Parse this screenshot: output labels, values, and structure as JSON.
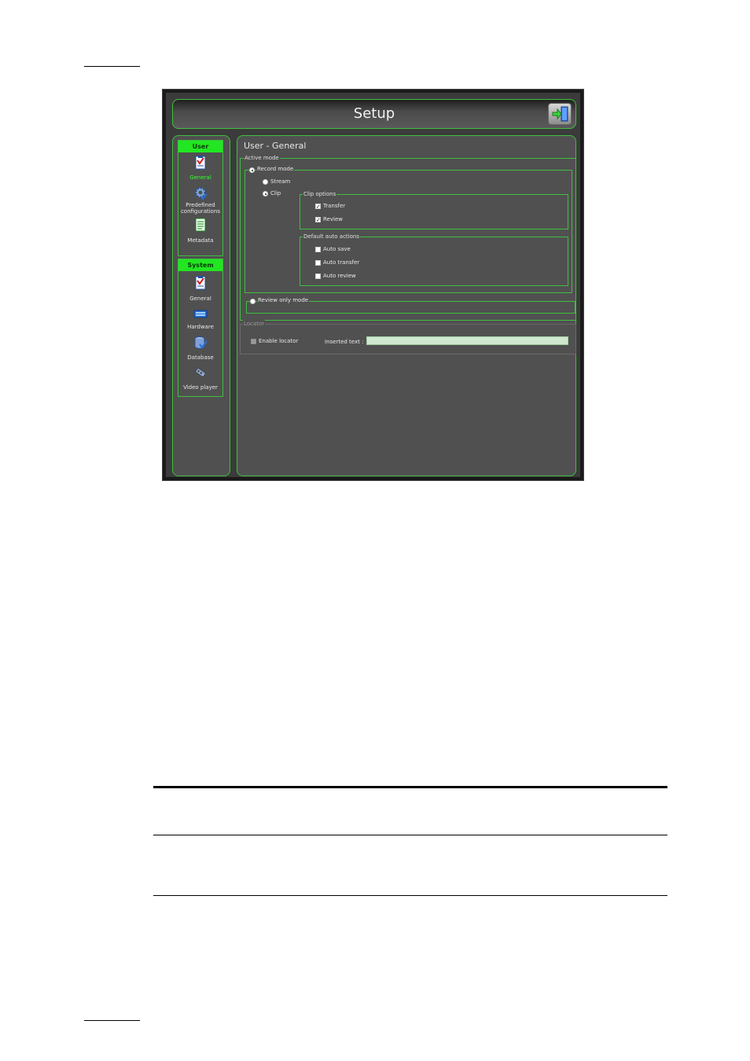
{
  "window": {
    "title": "Setup",
    "exit_icon": "exit-door-icon"
  },
  "sidebar": {
    "user_group": {
      "label": "User",
      "items": [
        {
          "label": "General",
          "icon": "checklist-icon",
          "active": true
        },
        {
          "label": "Predefined configurations",
          "icon": "gear-icon"
        },
        {
          "label": "Metadata",
          "icon": "document-icon"
        }
      ]
    },
    "system_group": {
      "label": "System",
      "items": [
        {
          "label": "General",
          "icon": "checklist-icon"
        },
        {
          "label": "Hardware",
          "icon": "hardware-icon"
        },
        {
          "label": "Database",
          "icon": "database-icon"
        },
        {
          "label": "Video player",
          "icon": "film-icon"
        }
      ]
    }
  },
  "main": {
    "title": "User - General",
    "active_mode": {
      "legend": "Active mode",
      "record_mode": {
        "label": "Record mode",
        "selected": true,
        "stream_label": "Stream",
        "clip_label": "Clip",
        "selected_option": "Clip",
        "clip_options": {
          "legend": "Clip options",
          "transfer_label": "Transfer",
          "transfer_checked": true,
          "review_label": "Review",
          "review_checked": true
        },
        "default_auto_actions": {
          "legend": "Default auto actions",
          "auto_save_label": "Auto save",
          "auto_transfer_label": "Auto transfer",
          "auto_review_label": "Auto review"
        }
      },
      "review_only_mode": {
        "label": "Review only mode",
        "selected": false
      }
    },
    "locator": {
      "legend": "Locator",
      "enable_label": "Enable locator",
      "inserted_text_label": "Inserted text :",
      "inserted_text_value": ""
    }
  },
  "colors": {
    "accent_green": "#3fbf3f",
    "header_green": "#22e622",
    "panel_bg": "#505050"
  }
}
